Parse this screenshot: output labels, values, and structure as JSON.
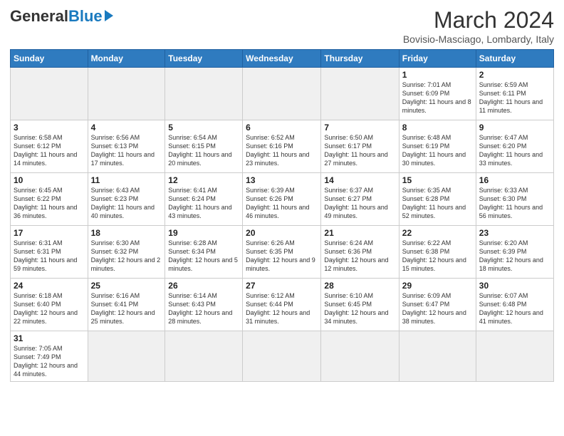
{
  "header": {
    "logo": {
      "general": "General",
      "blue": "Blue"
    },
    "title": "March 2024",
    "subtitle": "Bovisio-Masciago, Lombardy, Italy"
  },
  "weekdays": [
    "Sunday",
    "Monday",
    "Tuesday",
    "Wednesday",
    "Thursday",
    "Friday",
    "Saturday"
  ],
  "weeks": [
    [
      {
        "day": "",
        "info": ""
      },
      {
        "day": "",
        "info": ""
      },
      {
        "day": "",
        "info": ""
      },
      {
        "day": "",
        "info": ""
      },
      {
        "day": "",
        "info": ""
      },
      {
        "day": "1",
        "info": "Sunrise: 7:01 AM\nSunset: 6:09 PM\nDaylight: 11 hours\nand 8 minutes."
      },
      {
        "day": "2",
        "info": "Sunrise: 6:59 AM\nSunset: 6:11 PM\nDaylight: 11 hours\nand 11 minutes."
      }
    ],
    [
      {
        "day": "3",
        "info": "Sunrise: 6:58 AM\nSunset: 6:12 PM\nDaylight: 11 hours\nand 14 minutes."
      },
      {
        "day": "4",
        "info": "Sunrise: 6:56 AM\nSunset: 6:13 PM\nDaylight: 11 hours\nand 17 minutes."
      },
      {
        "day": "5",
        "info": "Sunrise: 6:54 AM\nSunset: 6:15 PM\nDaylight: 11 hours\nand 20 minutes."
      },
      {
        "day": "6",
        "info": "Sunrise: 6:52 AM\nSunset: 6:16 PM\nDaylight: 11 hours\nand 23 minutes."
      },
      {
        "day": "7",
        "info": "Sunrise: 6:50 AM\nSunset: 6:17 PM\nDaylight: 11 hours\nand 27 minutes."
      },
      {
        "day": "8",
        "info": "Sunrise: 6:48 AM\nSunset: 6:19 PM\nDaylight: 11 hours\nand 30 minutes."
      },
      {
        "day": "9",
        "info": "Sunrise: 6:47 AM\nSunset: 6:20 PM\nDaylight: 11 hours\nand 33 minutes."
      }
    ],
    [
      {
        "day": "10",
        "info": "Sunrise: 6:45 AM\nSunset: 6:22 PM\nDaylight: 11 hours\nand 36 minutes."
      },
      {
        "day": "11",
        "info": "Sunrise: 6:43 AM\nSunset: 6:23 PM\nDaylight: 11 hours\nand 40 minutes."
      },
      {
        "day": "12",
        "info": "Sunrise: 6:41 AM\nSunset: 6:24 PM\nDaylight: 11 hours\nand 43 minutes."
      },
      {
        "day": "13",
        "info": "Sunrise: 6:39 AM\nSunset: 6:26 PM\nDaylight: 11 hours\nand 46 minutes."
      },
      {
        "day": "14",
        "info": "Sunrise: 6:37 AM\nSunset: 6:27 PM\nDaylight: 11 hours\nand 49 minutes."
      },
      {
        "day": "15",
        "info": "Sunrise: 6:35 AM\nSunset: 6:28 PM\nDaylight: 11 hours\nand 52 minutes."
      },
      {
        "day": "16",
        "info": "Sunrise: 6:33 AM\nSunset: 6:30 PM\nDaylight: 11 hours\nand 56 minutes."
      }
    ],
    [
      {
        "day": "17",
        "info": "Sunrise: 6:31 AM\nSunset: 6:31 PM\nDaylight: 11 hours\nand 59 minutes."
      },
      {
        "day": "18",
        "info": "Sunrise: 6:30 AM\nSunset: 6:32 PM\nDaylight: 12 hours\nand 2 minutes."
      },
      {
        "day": "19",
        "info": "Sunrise: 6:28 AM\nSunset: 6:34 PM\nDaylight: 12 hours\nand 5 minutes."
      },
      {
        "day": "20",
        "info": "Sunrise: 6:26 AM\nSunset: 6:35 PM\nDaylight: 12 hours\nand 9 minutes."
      },
      {
        "day": "21",
        "info": "Sunrise: 6:24 AM\nSunset: 6:36 PM\nDaylight: 12 hours\nand 12 minutes."
      },
      {
        "day": "22",
        "info": "Sunrise: 6:22 AM\nSunset: 6:38 PM\nDaylight: 12 hours\nand 15 minutes."
      },
      {
        "day": "23",
        "info": "Sunrise: 6:20 AM\nSunset: 6:39 PM\nDaylight: 12 hours\nand 18 minutes."
      }
    ],
    [
      {
        "day": "24",
        "info": "Sunrise: 6:18 AM\nSunset: 6:40 PM\nDaylight: 12 hours\nand 22 minutes."
      },
      {
        "day": "25",
        "info": "Sunrise: 6:16 AM\nSunset: 6:41 PM\nDaylight: 12 hours\nand 25 minutes."
      },
      {
        "day": "26",
        "info": "Sunrise: 6:14 AM\nSunset: 6:43 PM\nDaylight: 12 hours\nand 28 minutes."
      },
      {
        "day": "27",
        "info": "Sunrise: 6:12 AM\nSunset: 6:44 PM\nDaylight: 12 hours\nand 31 minutes."
      },
      {
        "day": "28",
        "info": "Sunrise: 6:10 AM\nSunset: 6:45 PM\nDaylight: 12 hours\nand 34 minutes."
      },
      {
        "day": "29",
        "info": "Sunrise: 6:09 AM\nSunset: 6:47 PM\nDaylight: 12 hours\nand 38 minutes."
      },
      {
        "day": "30",
        "info": "Sunrise: 6:07 AM\nSunset: 6:48 PM\nDaylight: 12 hours\nand 41 minutes."
      }
    ],
    [
      {
        "day": "31",
        "info": "Sunrise: 7:05 AM\nSunset: 7:49 PM\nDaylight: 12 hours\nand 44 minutes."
      },
      {
        "day": "",
        "info": ""
      },
      {
        "day": "",
        "info": ""
      },
      {
        "day": "",
        "info": ""
      },
      {
        "day": "",
        "info": ""
      },
      {
        "day": "",
        "info": ""
      },
      {
        "day": "",
        "info": ""
      }
    ]
  ]
}
